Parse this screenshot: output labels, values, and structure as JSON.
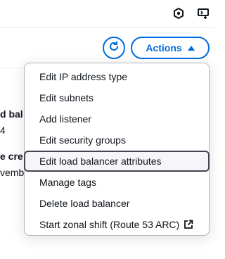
{
  "colors": {
    "accent": "#006ce0",
    "text": "#0f141a",
    "menu_border": "#b4b4bb",
    "highlight_border": "#424650"
  },
  "topbar": {
    "icons": [
      "settings-hex-icon",
      "notifications-icon"
    ]
  },
  "toolbar": {
    "refresh_icon": "refresh-icon",
    "actions_label": "Actions",
    "actions_caret": "caret-up-icon"
  },
  "background": {
    "lines": [
      {
        "text": "d bal"
      },
      {
        "text": "4"
      },
      {
        "text": "e cre"
      },
      {
        "text": "vembe"
      }
    ]
  },
  "menu": {
    "items": [
      {
        "label": "Edit IP address type"
      },
      {
        "label": "Edit subnets"
      },
      {
        "label": "Add listener"
      },
      {
        "label": "Edit security groups"
      },
      {
        "label": "Edit load balancer attributes",
        "highlighted": true
      },
      {
        "label": "Manage tags"
      },
      {
        "label": "Delete load balancer"
      },
      {
        "label": "Start zonal shift (Route 53 ARC)",
        "external_icon": "external-link-icon"
      }
    ]
  }
}
